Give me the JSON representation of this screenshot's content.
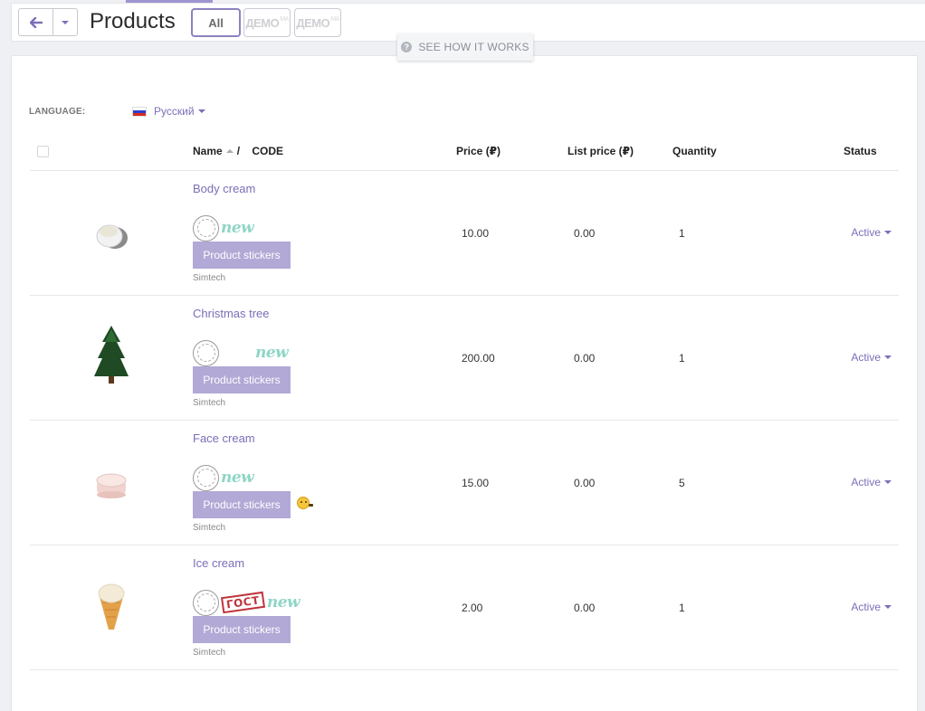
{
  "toolbar": {
    "title": "Products",
    "filters": [
      {
        "label": "All",
        "active": true
      },
      {
        "label": "ДЕМО",
        "suffix": "MA"
      },
      {
        "label": "ДЕМО",
        "suffix": "MA"
      }
    ],
    "hint": "SEE HOW IT WORKS"
  },
  "language": {
    "label": "LANGUAGE:",
    "selected": "Русский"
  },
  "table": {
    "columns": {
      "name": "Name",
      "separator": "/",
      "code": "CODE",
      "price": "Price (₽)",
      "list_price": "List price (₽)",
      "quantity": "Quantity",
      "status": "Status"
    },
    "rows": [
      {
        "name": "Body cream",
        "sticker_button": "Product stickers",
        "vendor": "Simtech",
        "price": "10.00",
        "list_price": "0.00",
        "quantity": "1",
        "status": "Active",
        "image_icon": "cream-jar-icon"
      },
      {
        "name": "Christmas tree",
        "sticker_button": "Product stickers",
        "vendor": "Simtech",
        "price": "200.00",
        "list_price": "0.00",
        "quantity": "1",
        "status": "Active",
        "image_icon": "christmas-tree-icon"
      },
      {
        "name": "Face cream",
        "sticker_button": "Product stickers",
        "vendor": "Simtech",
        "price": "15.00",
        "list_price": "0.00",
        "quantity": "5",
        "status": "Active",
        "image_icon": "face-cream-jar-icon"
      },
      {
        "name": "Ice cream",
        "sticker_button": "Product stickers",
        "vendor": "Simtech",
        "price": "2.00",
        "list_price": "0.00",
        "quantity": "1",
        "status": "Active",
        "image_icon": "ice-cream-cone-icon"
      }
    ]
  },
  "stickers": {
    "new_label": "new",
    "gost_label": "ГОСТ"
  },
  "colors": {
    "accent": "#7a6fb8",
    "sticker_button": "#b2a9d6",
    "new_badge": "#8fd6c6",
    "gost_badge": "#c0343c"
  }
}
